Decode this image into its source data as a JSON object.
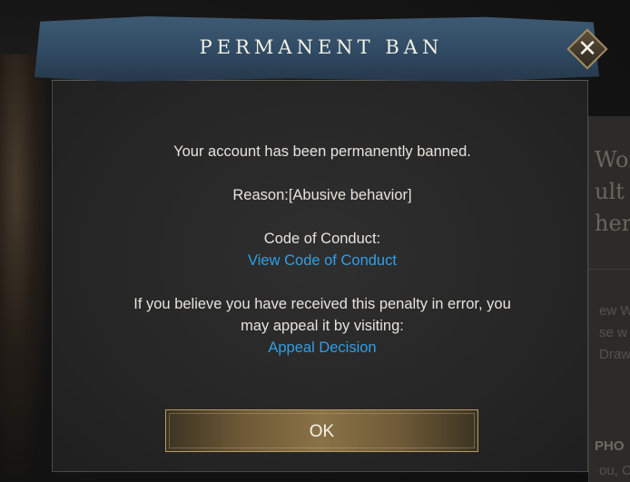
{
  "dialog": {
    "title": "PERMANENT BAN",
    "message": "Your account has been permanently banned.",
    "reason": "Reason:[Abusive behavior]",
    "conduct_label": "Code of Conduct:",
    "conduct_link": "View Code of Conduct",
    "appeal_line1": "If you believe you have received this penalty in error, you",
    "appeal_line2": "may appeal it by visiting:",
    "appeal_link": "Appeal Decision",
    "ok_label": "OK",
    "close_symbol": "✕"
  },
  "background": {
    "right_text_1": "Wor",
    "right_text_2": "ult",
    "right_text_3": "her",
    "right_small_1": "ew W",
    "right_small_2": "se w",
    "right_small_3": "Draw",
    "right_bold": "PHO",
    "right_small_4": "ou, C"
  },
  "colors": {
    "link": "#2f9fe7",
    "header": "#2f4a62",
    "button_gold": "#8a7246"
  }
}
